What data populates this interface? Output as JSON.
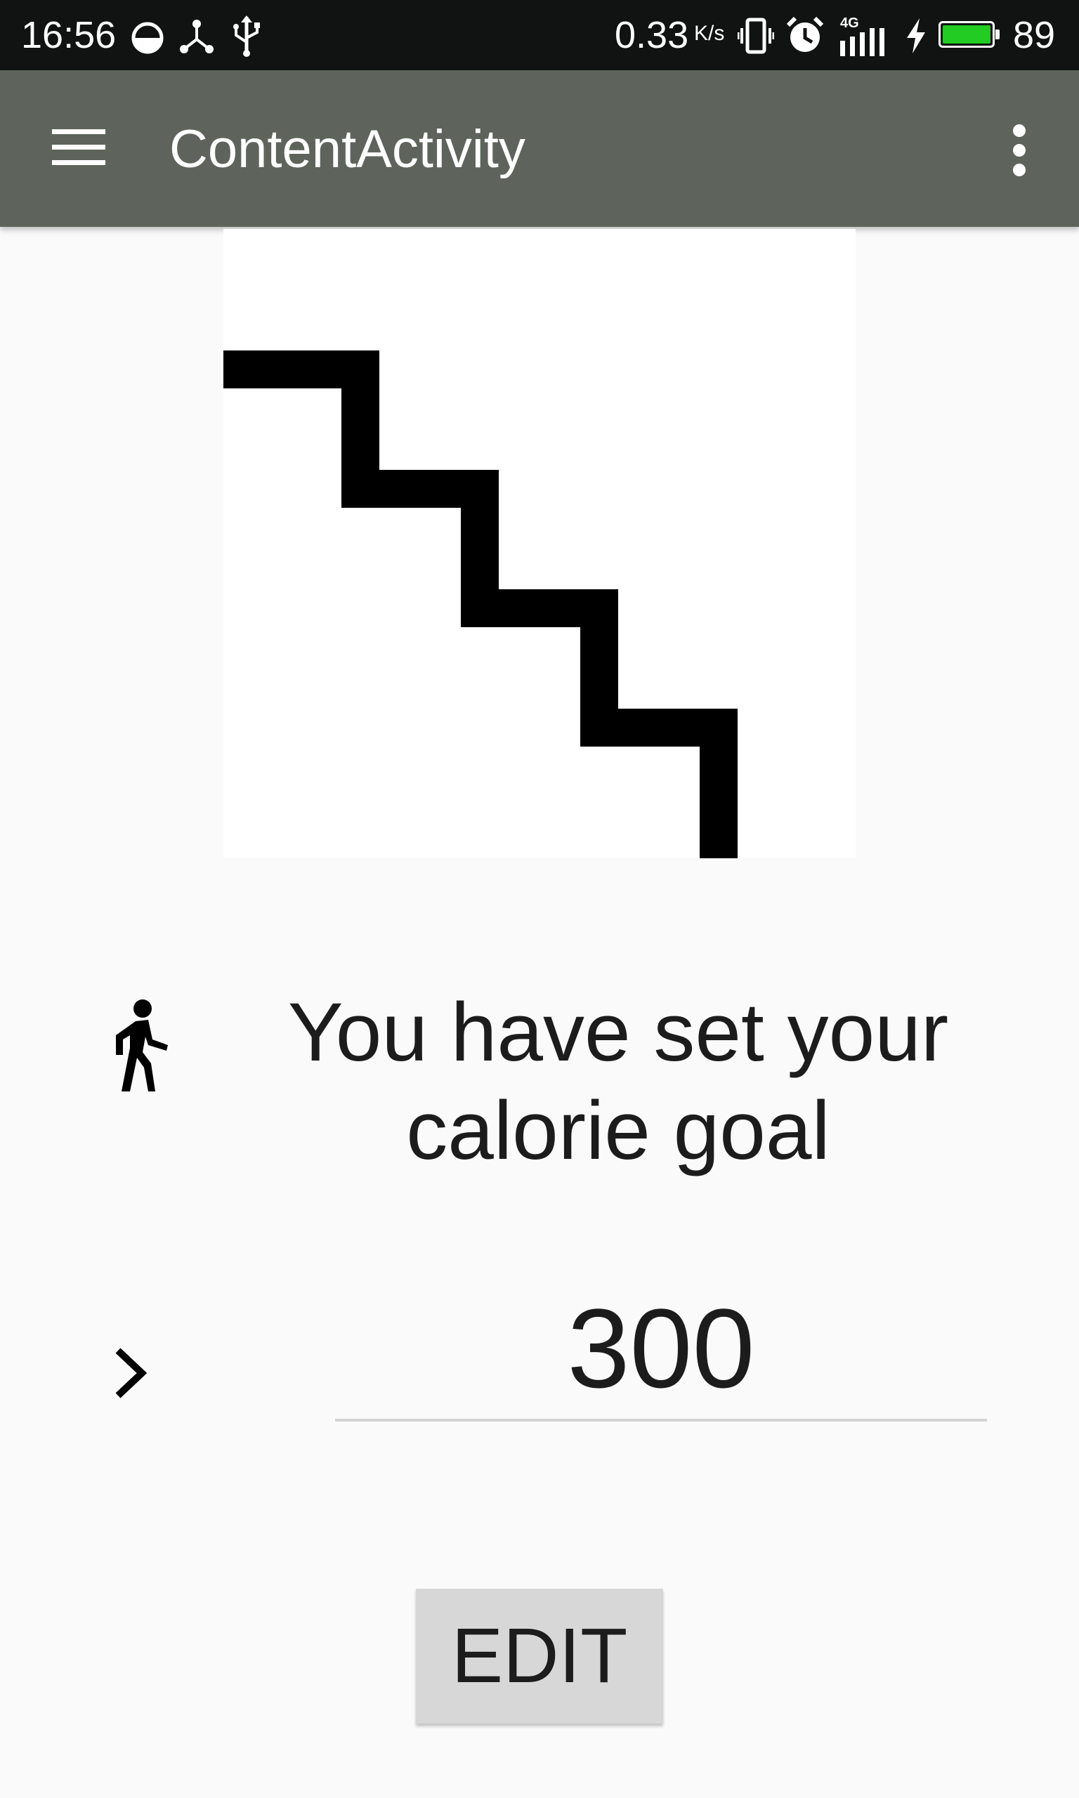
{
  "status_bar": {
    "time": "16:56",
    "network_speed": "0.33",
    "speed_unit": "K/s",
    "network_type": "4G",
    "battery_level": "89",
    "battery_color": "#22cc22"
  },
  "app_bar": {
    "title": "ContentActivity",
    "background_color": "#5e645c",
    "menu_icon": "hamburger-menu-icon",
    "overflow_icon": "more-vert-icon"
  },
  "main": {
    "image_icon": "stairs-icon",
    "message_icon": "directions-walk-icon",
    "goal_message": "You have set your calorie goal",
    "value_icon": "chevron-right-icon",
    "goal_value": "300",
    "edit_label": "EDIT"
  }
}
